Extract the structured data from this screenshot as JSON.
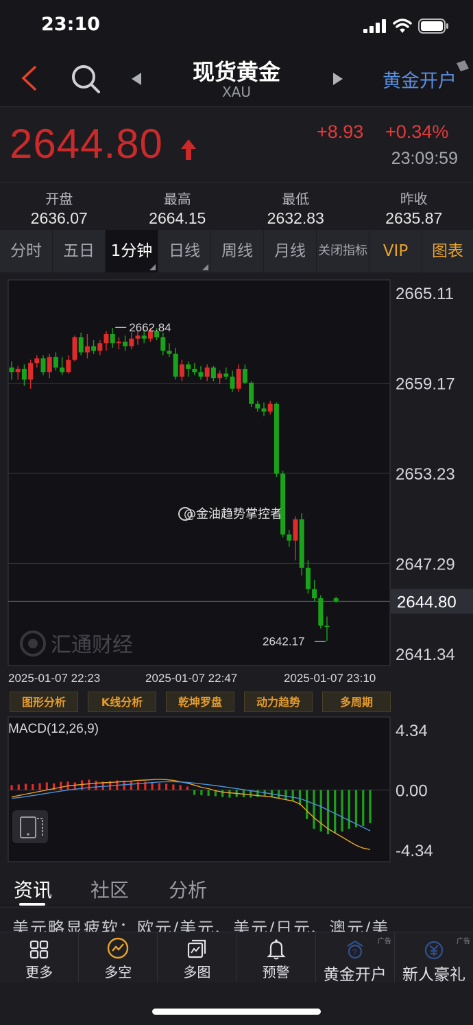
{
  "status_bar": {
    "time": "23:10"
  },
  "header": {
    "title": "现货黄金",
    "code": "XAU",
    "open_account": "黄金开户"
  },
  "quote": {
    "price": "2644.80",
    "change": "+8.93",
    "change_pct": "+0.34%",
    "time": "23:09:59"
  },
  "ohlc": [
    {
      "label": "开盘",
      "value": "2636.07"
    },
    {
      "label": "最高",
      "value": "2664.15"
    },
    {
      "label": "最低",
      "value": "2632.83"
    },
    {
      "label": "昨收",
      "value": "2635.87"
    }
  ],
  "period_tabs": [
    "分时",
    "五日",
    "1分钟",
    "日线",
    "周线",
    "月线",
    "关闭指标",
    "VIP",
    "图表"
  ],
  "active_tab": "1分钟",
  "watermarks": {
    "weibo": "@金油趋势掌控者",
    "brand": "汇通财经"
  },
  "tool_buttons": [
    "图形分析",
    "K线分析",
    "乾坤罗盘",
    "动力趋势",
    "多周期"
  ],
  "news_tabs": [
    "资讯",
    "社区",
    "分析"
  ],
  "headline": "美元略显疲软：欧元/美元、美元/日元、澳元/美",
  "bottom_nav": [
    {
      "label": "更多",
      "icon": "grid-icon",
      "ad": ""
    },
    {
      "label": "多空",
      "icon": "trend-circle-icon",
      "ad": ""
    },
    {
      "label": "多图",
      "icon": "multi-chart-icon",
      "ad": ""
    },
    {
      "label": "预警",
      "icon": "bell-icon",
      "ad": ""
    },
    {
      "label": "黄金开户",
      "icon": "gold-account-icon",
      "ad": "广告"
    },
    {
      "label": "新人豪礼",
      "icon": "gift-money-icon",
      "ad": "广告"
    }
  ],
  "colors": {
    "up": "#e02b2b",
    "down": "#1aa31a",
    "accent_gold": "#e9a42a",
    "link_blue": "#5b8fe0"
  },
  "chart_data": [
    {
      "type": "candlestick",
      "title": "",
      "ylim": [
        2641.34,
        2665.11
      ],
      "y_ticks": [
        "2665.11",
        "2659.17",
        "2653.23",
        "2647.29",
        "2641.34"
      ],
      "x_ticks": [
        "2025-01-07 22:23",
        "2025-01-07 22:47",
        "2025-01-07 23:10"
      ],
      "current_price": "2644.80",
      "high_label": "2662.84",
      "low_label": "2642.17",
      "candles": [
        [
          2660.2,
          2660.6,
          2659.4,
          2659.9
        ],
        [
          2659.9,
          2660.3,
          2659.4,
          2660.1
        ],
        [
          2660.1,
          2660.4,
          2659.0,
          2659.4
        ],
        [
          2659.4,
          2660.7,
          2658.8,
          2660.5
        ],
        [
          2660.5,
          2661.0,
          2660.2,
          2660.8
        ],
        [
          2660.8,
          2661.0,
          2659.7,
          2659.9
        ],
        [
          2659.9,
          2661.1,
          2659.5,
          2660.9
        ],
        [
          2660.9,
          2661.2,
          2660.0,
          2660.2
        ],
        [
          2660.2,
          2660.9,
          2659.7,
          2659.9
        ],
        [
          2659.9,
          2661.0,
          2659.8,
          2660.7
        ],
        [
          2660.7,
          2662.3,
          2660.6,
          2662.2
        ],
        [
          2662.2,
          2662.5,
          2661.0,
          2661.2
        ],
        [
          2661.2,
          2662.4,
          2660.8,
          2661.6
        ],
        [
          2661.6,
          2662.0,
          2661.1,
          2661.3
        ],
        [
          2661.3,
          2662.0,
          2661.0,
          2661.8
        ],
        [
          2661.8,
          2662.6,
          2661.3,
          2662.4
        ],
        [
          2662.4,
          2662.8,
          2661.5,
          2661.8
        ],
        [
          2661.8,
          2662.2,
          2661.4,
          2661.9
        ],
        [
          2661.9,
          2662.3,
          2661.3,
          2661.6
        ],
        [
          2661.6,
          2662.5,
          2661.4,
          2662.1
        ],
        [
          2662.1,
          2662.6,
          2661.7,
          2662.3
        ],
        [
          2662.3,
          2662.7,
          2661.8,
          2662.1
        ],
        [
          2662.1,
          2662.8,
          2661.9,
          2662.6
        ],
        [
          2662.6,
          2662.8,
          2662.0,
          2662.2
        ],
        [
          2662.2,
          2662.5,
          2661.0,
          2661.3
        ],
        [
          2661.3,
          2661.8,
          2660.9,
          2661.1
        ],
        [
          2661.1,
          2661.5,
          2659.4,
          2659.6
        ],
        [
          2659.6,
          2660.7,
          2659.3,
          2660.4
        ],
        [
          2660.4,
          2660.6,
          2659.6,
          2660.1
        ],
        [
          2660.1,
          2660.5,
          2659.7,
          2659.9
        ],
        [
          2659.9,
          2660.3,
          2659.4,
          2659.6
        ],
        [
          2659.6,
          2660.4,
          2659.3,
          2660.2
        ],
        [
          2660.2,
          2660.3,
          2659.3,
          2659.5
        ],
        [
          2659.5,
          2660.0,
          2659.1,
          2659.8
        ],
        [
          2659.8,
          2660.2,
          2659.4,
          2659.6
        ],
        [
          2659.6,
          2660.0,
          2658.6,
          2658.8
        ],
        [
          2658.8,
          2660.4,
          2658.6,
          2660.1
        ],
        [
          2660.1,
          2660.4,
          2659.1,
          2659.2
        ],
        [
          2659.2,
          2659.3,
          2657.6,
          2657.8
        ],
        [
          2657.8,
          2658.0,
          2657.3,
          2657.5
        ],
        [
          2657.5,
          2657.9,
          2657.0,
          2657.3
        ],
        [
          2657.3,
          2658.0,
          2657.1,
          2657.8
        ],
        [
          2657.8,
          2657.9,
          2653.0,
          2653.2
        ],
        [
          2653.2,
          2653.4,
          2649.0,
          2649.2
        ],
        [
          2649.2,
          2649.5,
          2648.4,
          2648.8
        ],
        [
          2648.8,
          2650.4,
          2647.5,
          2650.2
        ],
        [
          2650.2,
          2650.6,
          2646.5,
          2647.0
        ],
        [
          2647.0,
          2647.5,
          2645.3,
          2645.6
        ],
        [
          2645.6,
          2646.2,
          2644.8,
          2645.0
        ],
        [
          2645.0,
          2645.2,
          2643.0,
          2643.2
        ],
        [
          2643.2,
          2643.8,
          2642.2,
          2643.1
        ],
        [
          2645.0,
          2645.1,
          2644.7,
          2644.8
        ]
      ]
    },
    {
      "type": "macd",
      "title": "MACD(12,26,9)",
      "ylim": [
        -4.34,
        4.34
      ],
      "y_ticks": [
        "4.34",
        "0.00",
        "-4.34"
      ],
      "histogram": [
        0.35,
        0.4,
        0.45,
        0.42,
        0.5,
        0.55,
        0.48,
        0.6,
        0.62,
        0.55,
        0.7,
        0.75,
        0.68,
        0.6,
        0.65,
        0.7,
        0.66,
        0.62,
        0.58,
        0.6,
        0.55,
        0.5,
        0.45,
        0.4,
        0.35,
        0.25,
        -0.35,
        -0.38,
        -0.42,
        -0.45,
        -0.5,
        -0.55,
        -0.5,
        -0.52,
        -0.55,
        -0.5,
        -0.45,
        -0.48,
        -0.6,
        -0.7,
        -0.8,
        -1.1,
        -2.1,
        -2.8,
        -3.0,
        -3.2,
        -3.1,
        -3.0,
        -2.8,
        -2.7,
        -2.6,
        -2.4
      ],
      "dif": [
        -0.5,
        -0.4,
        -0.3,
        -0.2,
        -0.1,
        0.0,
        0.1,
        0.2,
        0.3,
        0.35,
        0.4,
        0.45,
        0.5,
        0.52,
        0.55,
        0.58,
        0.62,
        0.65,
        0.7,
        0.72,
        0.75,
        0.78,
        0.75,
        0.7,
        0.6,
        0.5,
        0.35,
        0.2,
        0.1,
        -0.05,
        -0.15,
        -0.2,
        -0.25,
        -0.3,
        -0.35,
        -0.4,
        -0.45,
        -0.5,
        -0.6,
        -0.7,
        -0.8,
        -1.0,
        -1.5,
        -2.0,
        -2.4,
        -2.8,
        -3.1,
        -3.4,
        -3.7,
        -4.0,
        -4.2,
        -4.3
      ],
      "dea": [
        -0.6,
        -0.55,
        -0.48,
        -0.4,
        -0.32,
        -0.24,
        -0.16,
        -0.08,
        0.0,
        0.06,
        0.12,
        0.18,
        0.22,
        0.26,
        0.3,
        0.34,
        0.38,
        0.42,
        0.46,
        0.5,
        0.54,
        0.58,
        0.6,
        0.6,
        0.58,
        0.55,
        0.5,
        0.44,
        0.38,
        0.32,
        0.25,
        0.18,
        0.1,
        0.03,
        -0.05,
        -0.12,
        -0.2,
        -0.28,
        -0.36,
        -0.44,
        -0.52,
        -0.62,
        -0.8,
        -1.0,
        -1.2,
        -1.45,
        -1.7,
        -1.95,
        -2.2,
        -2.45,
        -2.7,
        -2.95
      ]
    }
  ]
}
